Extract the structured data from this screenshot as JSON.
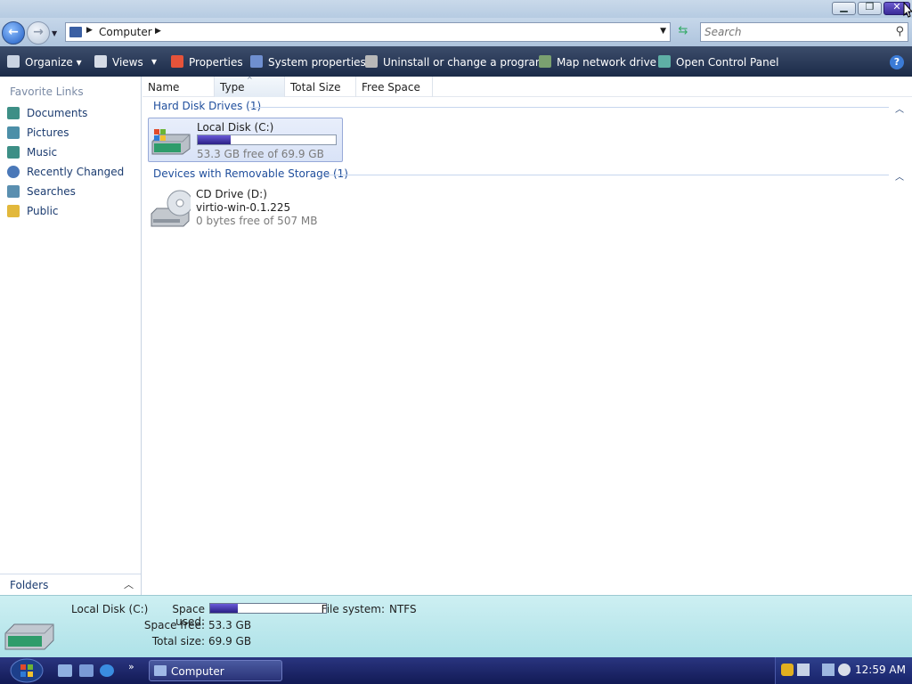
{
  "window": {
    "minimize_glyph": "▁",
    "maximize_glyph": "❐",
    "close_glyph": "✕"
  },
  "nav": {
    "back_glyph": "←",
    "forward_glyph": "→",
    "address_icon": "computer-icon",
    "breadcrumb": "Computer",
    "search_placeholder": "Search"
  },
  "toolbar": {
    "organize": "Organize",
    "views": "Views",
    "properties": "Properties",
    "system_properties": "System properties",
    "uninstall": "Uninstall or change a program",
    "map_drive": "Map network drive",
    "control_panel": "Open Control Panel",
    "help_glyph": "?"
  },
  "sidebar": {
    "header": "Favorite Links",
    "items": [
      {
        "label": "Documents",
        "icon": "documents-icon",
        "color": "#3d8f86"
      },
      {
        "label": "Pictures",
        "icon": "pictures-icon",
        "color": "#4c8fa8"
      },
      {
        "label": "Music",
        "icon": "music-icon",
        "color": "#3d8f86"
      },
      {
        "label": "Recently Changed",
        "icon": "recent-icon",
        "color": "#4a78b8"
      },
      {
        "label": "Searches",
        "icon": "searches-icon",
        "color": "#5a8fb0"
      },
      {
        "label": "Public",
        "icon": "public-folder-icon",
        "color": "#e2b83b"
      }
    ],
    "folders_label": "Folders"
  },
  "columns": [
    "Name",
    "Type",
    "Total Size",
    "Free Space"
  ],
  "groups": {
    "hard_disks": "Hard Disk Drives (1)",
    "removable": "Devices with Removable Storage (1)"
  },
  "drives": {
    "c": {
      "name": "Local Disk (C:)",
      "free_text": "53.3 GB free of 69.9 GB",
      "used_fraction": 0.24
    },
    "d": {
      "name": "CD Drive (D:)",
      "label": "virtio-win-0.1.225",
      "free_text": "0 bytes free of 507 MB"
    }
  },
  "details": {
    "title": "Local Disk (C:)",
    "space_used_label": "Space used:",
    "space_free_label": "Space free:",
    "space_free_value": "53.3 GB",
    "total_size_label": "Total size:",
    "total_size_value": "69.9 GB",
    "fs_label": "File system:",
    "fs_value": "NTFS",
    "used_fraction": 0.24
  },
  "taskbar": {
    "window_label": "Computer",
    "more_glyph": "»",
    "clock": "12:59 AM"
  },
  "colors": {
    "accent_bar": "#2a1f85",
    "link": "#1c3c70",
    "group_header": "#1f4e9c"
  }
}
